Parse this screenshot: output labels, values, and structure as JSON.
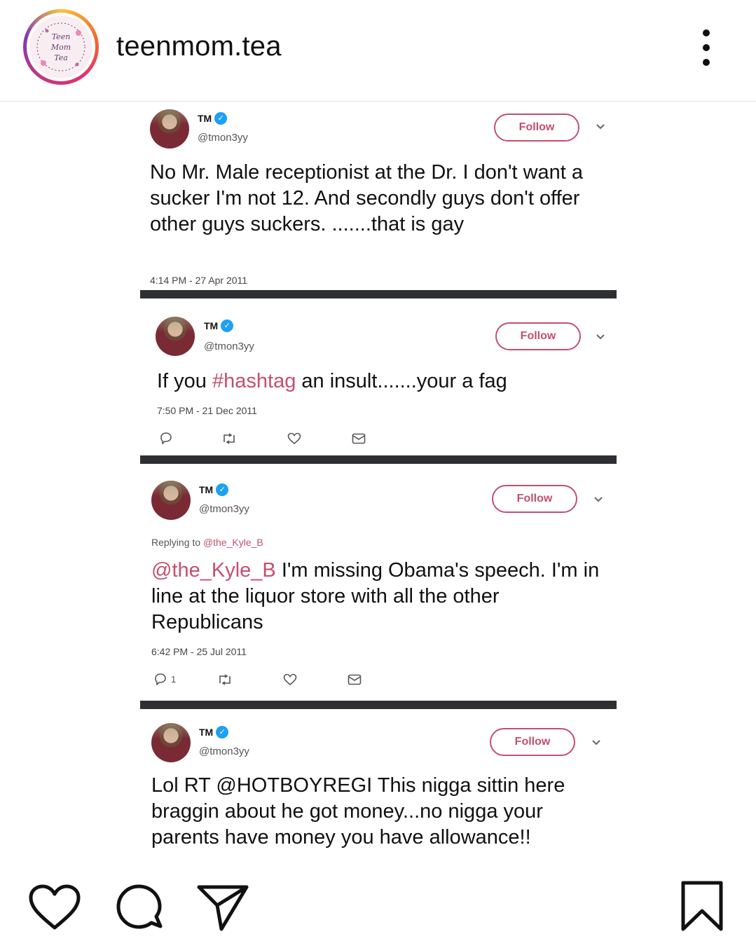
{
  "header": {
    "username": "teenmom.tea",
    "avatar_alt": "Teen Mom Tea",
    "logo_lines": [
      "Teen",
      "Mom",
      "Tea"
    ]
  },
  "tweets": [
    {
      "name": "TM",
      "handle": "@tmon3yy",
      "follow_label": "Follow",
      "text": "No Mr. Male receptionist at the Dr. I don't want a sucker I'm not 12. And secondly guys don't offer other guys suckers. .......that is gay",
      "timestamp": "4:14 PM - 27 Apr 2011"
    },
    {
      "name": "TM",
      "handle": "@tmon3yy",
      "follow_label": "Follow",
      "text_before": "If you ",
      "hashtag": "#hashtag",
      "text_after": " an insult.......your a fag",
      "timestamp": "7:50 PM - 21 Dec 2011"
    },
    {
      "name": "TM",
      "handle": "@tmon3yy",
      "follow_label": "Follow",
      "reply_prefix": "Replying to ",
      "reply_to": "@the_Kyle_B",
      "mention": "@the_Kyle_B",
      "text_after": " I'm missing Obama's speech. I'm in line at the liquor store with all the other Republicans",
      "timestamp": "6:42 PM - 25 Jul 2011",
      "reply_count": "1"
    },
    {
      "name": "TM",
      "handle": "@tmon3yy",
      "follow_label": "Follow",
      "text": "Lol RT @HOTBOYREGI This nigga sittin here braggin about he got money...no nigga your parents have money you have allowance!!"
    }
  ],
  "colors": {
    "accent": "#c44f6e",
    "verified": "#1da1f2",
    "divider": "#2d2f33"
  },
  "icons": {
    "more": "more-vertical-icon",
    "like": "heart-icon",
    "comment": "comment-icon",
    "share": "send-icon",
    "save": "bookmark-icon"
  }
}
